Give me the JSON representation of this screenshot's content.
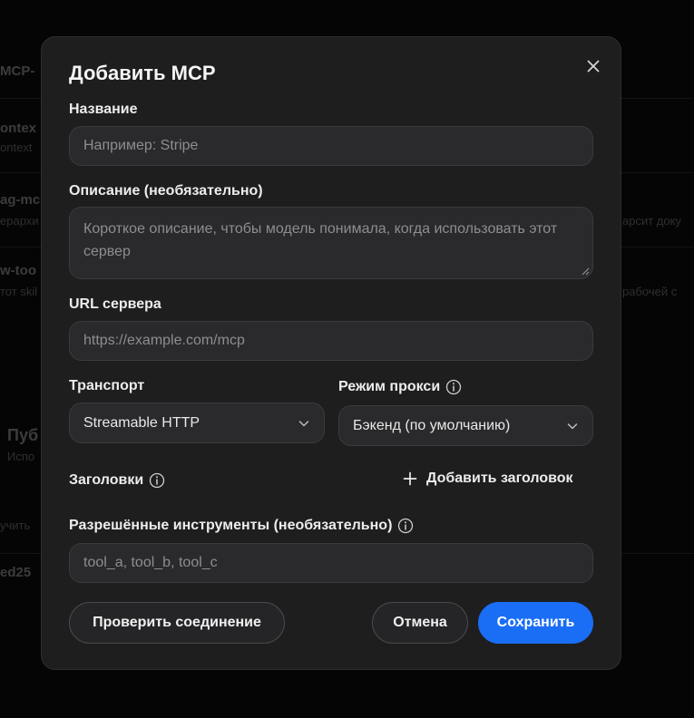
{
  "background": {
    "items": [
      {
        "title": "MCP-",
        "sub": ""
      },
      {
        "title": "ontex",
        "sub": "ontext"
      },
      {
        "title": "ag-mc",
        "sub": "ерархи",
        "right": "арсит доку"
      },
      {
        "title": "w-too",
        "sub": "тот skil",
        "right": "рабочей с"
      },
      {
        "title": "Пуб",
        "sub": "Испо"
      },
      {
        "title": "",
        "sub": "учить"
      },
      {
        "title": "ed25",
        "sub": ""
      }
    ]
  },
  "dialog": {
    "title": "Добавить MCP",
    "close_icon": "close-icon",
    "name": {
      "label": "Название",
      "placeholder": "Например: Stripe",
      "value": ""
    },
    "description": {
      "label": "Описание (необязательно)",
      "placeholder": "Короткое описание, чтобы модель понимала, когда использовать этот сервер",
      "value": ""
    },
    "url": {
      "label": "URL сервера",
      "placeholder": "https://example.com/mcp",
      "value": ""
    },
    "transport": {
      "label": "Транспорт",
      "selected": "Streamable HTTP"
    },
    "proxy_mode": {
      "label": "Режим прокси",
      "selected": "Бэкенд (по умолчанию)"
    },
    "headers": {
      "label": "Заголовки",
      "add_label": "Добавить заголовок"
    },
    "allowed_tools": {
      "label": "Разрешённые инструменты (необязательно)",
      "placeholder": "tool_a, tool_b, tool_c",
      "value": ""
    },
    "buttons": {
      "test": "Проверить соединение",
      "cancel": "Отмена",
      "save": "Сохранить"
    },
    "colors": {
      "accent": "#1a6ef5",
      "surface": "#1e1e1f",
      "field": "#2a2a2c"
    }
  }
}
